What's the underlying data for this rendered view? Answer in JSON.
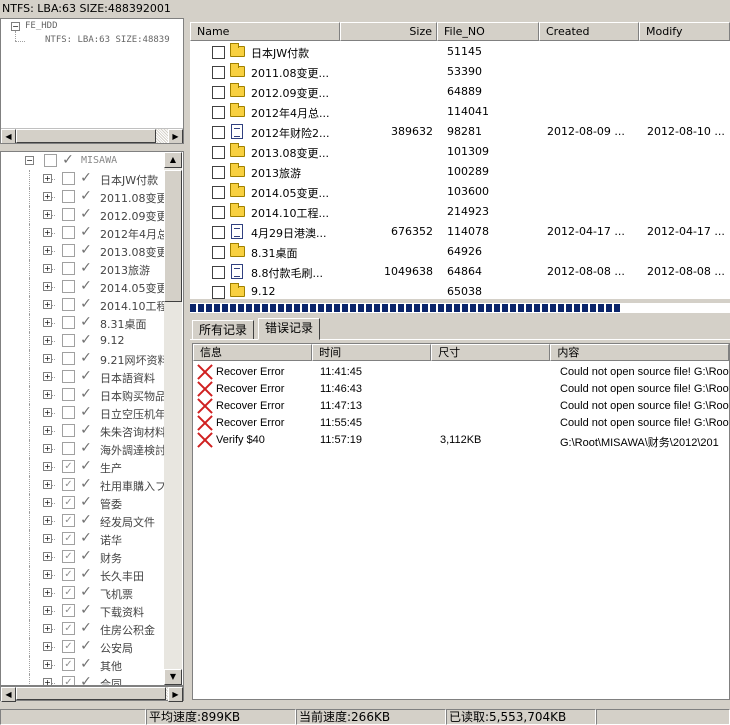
{
  "title_bar": "NTFS: LBA:63 SIZE:488392001",
  "top_tree": {
    "root": "FE_HDD",
    "child": "NTFS: LBA:63 SIZE:48839"
  },
  "left_tree": {
    "root": "MISAWA",
    "items": [
      {
        "label": "日本JW付款",
        "checked": false
      },
      {
        "label": "2011.08变更",
        "checked": false
      },
      {
        "label": "2012.09变更",
        "checked": false
      },
      {
        "label": "2012年4月总",
        "checked": false
      },
      {
        "label": "2013.08变更",
        "checked": false
      },
      {
        "label": "2013旅游",
        "checked": false
      },
      {
        "label": "2014.05变更",
        "checked": false
      },
      {
        "label": "2014.10工程",
        "checked": false
      },
      {
        "label": "8.31桌面",
        "checked": false
      },
      {
        "label": "9.12",
        "checked": false
      },
      {
        "label": "9.21网坏资料",
        "checked": false
      },
      {
        "label": "日本語資料",
        "checked": false
      },
      {
        "label": "日本购买物品",
        "checked": false
      },
      {
        "label": "日立空压机年",
        "checked": false
      },
      {
        "label": "朱朱咨询材料",
        "checked": false
      },
      {
        "label": "海外調達検討",
        "checked": false
      },
      {
        "label": "生产",
        "checked": true
      },
      {
        "label": "社用車購入フ",
        "checked": true
      },
      {
        "label": "管委",
        "checked": true
      },
      {
        "label": "经发局文件",
        "checked": true
      },
      {
        "label": "诺华",
        "checked": true
      },
      {
        "label": "财务",
        "checked": true
      },
      {
        "label": "长久丰田",
        "checked": true
      },
      {
        "label": "飞机票",
        "checked": true
      },
      {
        "label": "下载资料",
        "checked": true
      },
      {
        "label": "住房公积金",
        "checked": true
      },
      {
        "label": "公安局",
        "checked": true
      },
      {
        "label": "其他",
        "checked": true
      },
      {
        "label": "合同",
        "checked": true
      }
    ]
  },
  "file_list": {
    "columns": [
      "Name",
      "Size",
      "File_NO",
      "Created",
      "Modify"
    ],
    "rows": [
      {
        "name": "日本JW付款",
        "type": "folder",
        "size": "",
        "file_no": "51145",
        "created": "",
        "modify": ""
      },
      {
        "name": "2011.08变更...",
        "type": "folder",
        "size": "",
        "file_no": "53390",
        "created": "",
        "modify": ""
      },
      {
        "name": "2012.09变更...",
        "type": "folder",
        "size": "",
        "file_no": "64889",
        "created": "",
        "modify": ""
      },
      {
        "name": "2012年4月总...",
        "type": "folder",
        "size": "",
        "file_no": "114041",
        "created": "",
        "modify": ""
      },
      {
        "name": "2012年财险2...",
        "type": "doc",
        "size": "389632",
        "file_no": "98281",
        "created": "2012-08-09 ...",
        "modify": "2012-08-10 ..."
      },
      {
        "name": "2013.08变更...",
        "type": "folder",
        "size": "",
        "file_no": "101309",
        "created": "",
        "modify": ""
      },
      {
        "name": "2013旅游",
        "type": "folder",
        "size": "",
        "file_no": "100289",
        "created": "",
        "modify": ""
      },
      {
        "name": "2014.05变更...",
        "type": "folder",
        "size": "",
        "file_no": "103600",
        "created": "",
        "modify": ""
      },
      {
        "name": "2014.10工程...",
        "type": "folder",
        "size": "",
        "file_no": "214923",
        "created": "",
        "modify": ""
      },
      {
        "name": "4月29日港澳...",
        "type": "doc",
        "size": "676352",
        "file_no": "114078",
        "created": "2012-04-17 ...",
        "modify": "2012-04-17 ..."
      },
      {
        "name": "8.31桌面",
        "type": "folder",
        "size": "",
        "file_no": "64926",
        "created": "",
        "modify": ""
      },
      {
        "name": "8.8付款毛刷...",
        "type": "doc",
        "size": "1049638",
        "file_no": "64864",
        "created": "2012-08-08 ...",
        "modify": "2012-08-08 ..."
      },
      {
        "name": "9.12",
        "type": "folder",
        "size": "",
        "file_no": "65038",
        "created": "",
        "modify": ""
      }
    ]
  },
  "tabs": [
    "所有记录",
    "错误记录"
  ],
  "log": {
    "columns": [
      "信息",
      "时间",
      "尺寸",
      "内容"
    ],
    "rows": [
      {
        "info": "Recover Error",
        "time": "11:41:45",
        "size": "",
        "content": "Could not open source file! G:\\Root\\"
      },
      {
        "info": "Recover Error",
        "time": "11:46:43",
        "size": "",
        "content": "Could not open source file! G:\\Root\\"
      },
      {
        "info": "Recover Error",
        "time": "11:47:13",
        "size": "",
        "content": "Could not open source file! G:\\Root\\"
      },
      {
        "info": "Recover Error",
        "time": "11:55:45",
        "size": "",
        "content": "Could not open source file! G:\\Root\\"
      },
      {
        "info": "Verify $40",
        "time": "11:57:19",
        "size": "3,112KB",
        "content": "G:\\Root\\MISAWA\\财务\\2012\\201"
      }
    ]
  },
  "status": {
    "avg_speed": "平均速度:899KB",
    "cur_speed": "当前速度:266KB",
    "read": "已读取:5,553,704KB"
  }
}
